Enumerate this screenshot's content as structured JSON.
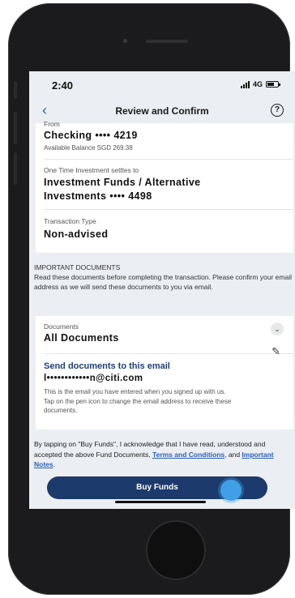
{
  "status_bar": {
    "time": "2:40",
    "network": "4G"
  },
  "nav": {
    "back_icon": "chevron-left-icon",
    "title": "Review and Confirm",
    "help_icon": "question-circle-icon",
    "help_label": "?"
  },
  "from_card": {
    "label": "From",
    "account": "Checking •••• 4219",
    "balance": "Available Balance SGD 269.38",
    "to_label": "One Time Investment settles to",
    "to_account_line1": "Investment Funds / Alternative",
    "to_account_line2": "Investments •••• 4498",
    "type_label": "Transaction Type",
    "type_value": "Non-advised"
  },
  "important": {
    "heading": "IMPORTANT DOCUMENTS",
    "text": "Read these documents before completing the transaction. Please confirm your email address as we will send these documents to you via email."
  },
  "documents_card": {
    "label": "Documents",
    "value": "All Documents",
    "expand_icon": "chevron-down-icon",
    "email_title": "Send documents to this email",
    "email": "l••••••••••••n@citi.com",
    "email_note": "This is the email you have entered when you signed up with us. Tap on the pen icon to change the email address to receive these documents.",
    "edit_icon": "pen-icon"
  },
  "consent": {
    "text": "By tapping on \"Buy Funds\", I acknowledge that I have read, understood and accepted the above Fund Documents,",
    "link1": "Terms and Conditions",
    "mid": ", and",
    "link2": "Important Notes",
    "end": "."
  },
  "buy_button": {
    "label": "Buy Funds"
  },
  "colors": {
    "accent": "#2c5fbd",
    "button": "#1c3a6b",
    "tap_indicator": "#3fa0e6"
  }
}
